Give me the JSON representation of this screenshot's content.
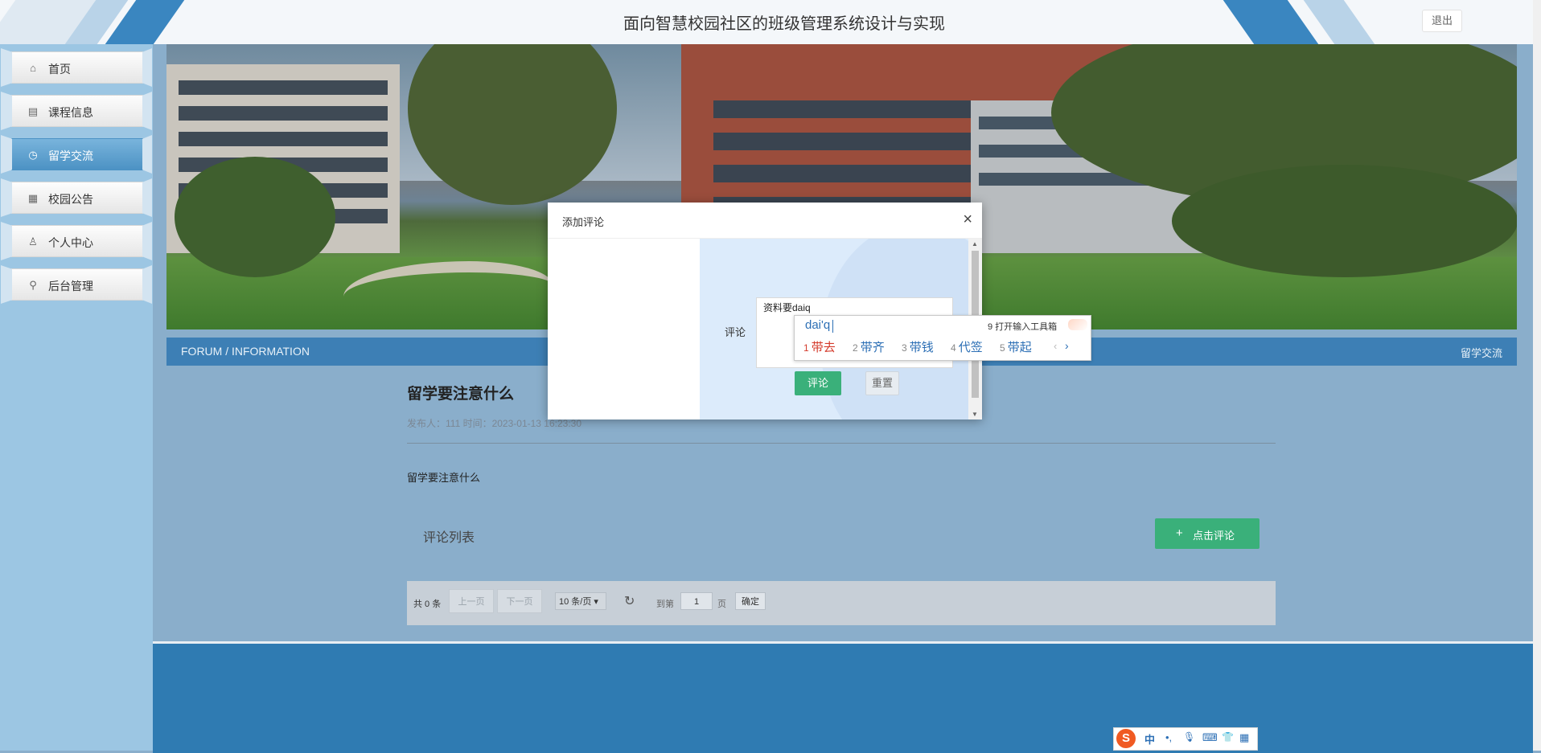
{
  "header": {
    "site_title": "面向智慧校园社区的班级管理系统设计与实现",
    "logout_label": "退出"
  },
  "sidebar": {
    "items": [
      {
        "label": "首页",
        "icon": "home-icon",
        "glyph": "⌂",
        "active": false
      },
      {
        "label": "课程信息",
        "icon": "document-icon",
        "glyph": "▤",
        "active": false
      },
      {
        "label": "留学交流",
        "icon": "clock-icon",
        "glyph": "◷",
        "active": true
      },
      {
        "label": "校园公告",
        "icon": "notice-icon",
        "glyph": "▦",
        "active": false
      },
      {
        "label": "个人中心",
        "icon": "user-icon",
        "glyph": "♙",
        "active": false
      },
      {
        "label": "后台管理",
        "icon": "link-icon",
        "glyph": "⚲",
        "active": false
      }
    ]
  },
  "forum_bar": {
    "title": "FORUM / INFORMATION",
    "crumb": "留学交流"
  },
  "post": {
    "title": "留学要注意什么",
    "meta": "发布人：111 时间：2023-01-13 16:23:30",
    "body": "留学要注意什么"
  },
  "comments": {
    "title": "评论列表",
    "add_button": "点击评论",
    "add_icon": "+"
  },
  "pager": {
    "total": "共 0 条",
    "prev": "上一页",
    "next": "下一页",
    "page_size": "10 条/页",
    "goto": "到第",
    "page": "1",
    "page_suffix": "页",
    "confirm": "确定"
  },
  "modal": {
    "title": "添加评论",
    "close": "×",
    "field_label": "评论",
    "textarea_value": "资料要daiq",
    "submit": "评论",
    "reset": "重置"
  },
  "ime": {
    "composition": "dai'q",
    "tool_label": "9 打开输入工具箱",
    "candidates": [
      {
        "n": "1",
        "w": "带去"
      },
      {
        "n": "2",
        "w": "带齐"
      },
      {
        "n": "3",
        "w": "带钱"
      },
      {
        "n": "4",
        "w": "代签"
      },
      {
        "n": "5",
        "w": "带起"
      }
    ],
    "prev": "‹",
    "next": "›"
  },
  "ime_toolbar": {
    "logo": "S",
    "mode": "中",
    "punct": "•,",
    "mic": "🎙",
    "keyboard": "⌨",
    "skin": "👕",
    "apps": "▦"
  },
  "colors": {
    "accent_blue": "#3d7fb5",
    "green": "#3ab07a",
    "sidebar_active": "#4c92c4"
  }
}
